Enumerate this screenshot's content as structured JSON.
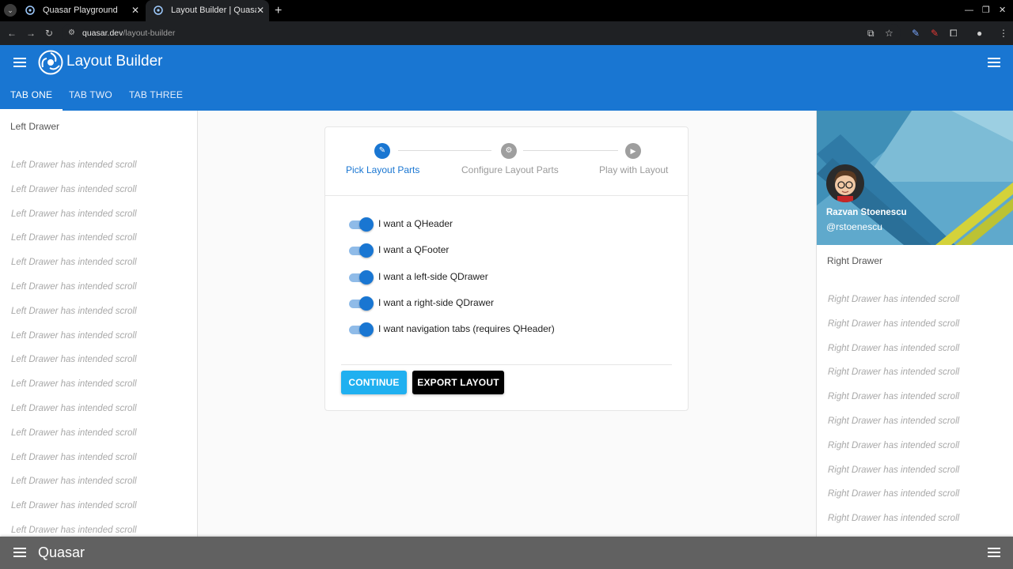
{
  "browser": {
    "tabs": [
      {
        "title": "Quasar Playground",
        "active": false
      },
      {
        "title": "Layout Builder | Quasar",
        "active": true
      }
    ],
    "url_domain": "quasar.dev",
    "url_path": "/layout-builder"
  },
  "header": {
    "title": "Layout Builder",
    "tabs": [
      "TAB ONE",
      "TAB TWO",
      "TAB THREE"
    ],
    "active_tab": "TAB ONE",
    "color": "#1976d2"
  },
  "left_drawer": {
    "title": "Left Drawer",
    "item_text": "Left Drawer has intended scroll"
  },
  "stepper": {
    "steps": [
      {
        "label": "Pick Layout Parts",
        "icon": "pencil-icon",
        "active": true
      },
      {
        "label": "Configure Layout Parts",
        "icon": "gear-icon",
        "active": false
      },
      {
        "label": "Play with Layout",
        "icon": "play-icon",
        "active": false
      }
    ],
    "options": [
      {
        "label": "I want a QHeader",
        "checked": true
      },
      {
        "label": "I want a QFooter",
        "checked": true
      },
      {
        "label": "I want a left-side QDrawer",
        "checked": true
      },
      {
        "label": "I want a right-side QDrawer",
        "checked": true
      },
      {
        "label": "I want navigation tabs (requires QHeader)",
        "checked": true
      }
    ],
    "continue_label": "CONTINUE",
    "export_label": "EXPORT LAYOUT"
  },
  "right_drawer": {
    "profile_name": "Razvan Stoenescu",
    "profile_handle": "@rstoenescu",
    "title": "Right Drawer",
    "item_text": "Right Drawer has intended scroll"
  },
  "footer": {
    "title": "Quasar",
    "color": "#616161"
  }
}
